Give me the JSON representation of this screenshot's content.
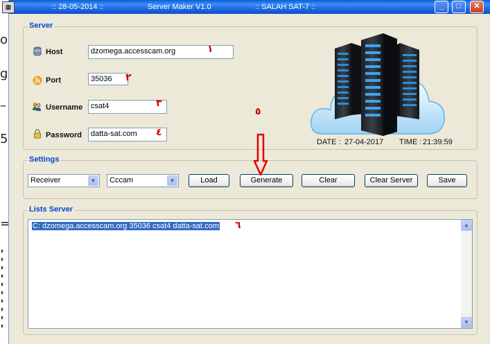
{
  "background": {
    "frag1": "o",
    "frag2": "g",
    "frag3": "–",
    "frag4": "5",
    "frag5": "="
  },
  "titlebar": {
    "date_text": ":: 28-05-2014 ::",
    "app_title": "Server Maker V1.0",
    "author": ":: SALAH SAT-7 ::"
  },
  "server": {
    "legend": "Server",
    "host_label": "Host",
    "host_value": "dzomega.accesscam.org",
    "port_label": "Port",
    "port_value": "35036",
    "username_label": "Username",
    "username_value": "csat4",
    "password_label": "Password",
    "password_value": "datta-sat.com",
    "date_label": "DATE :",
    "date_value": "27-04-2017",
    "time_label": "TIME :",
    "time_value": "21:39:59"
  },
  "annotations": {
    "n1": "١",
    "n2": "٢",
    "n3": "٣",
    "n4": "٤",
    "n5": "٥",
    "n6": "٦"
  },
  "settings": {
    "legend": "Settings",
    "receiver_selected": "Receiver",
    "protocol_selected": "Cccam",
    "load_label": "Load",
    "generate_label": "Generate",
    "clear_label": "Clear",
    "clear_server_label": "Clear Server",
    "save_label": "Save"
  },
  "lists": {
    "legend": "Lists Server",
    "items": [
      "C: dzomega.accesscam.org 35036 csat4 datta-sat.com"
    ]
  },
  "icons": {
    "app": "app-icon",
    "host": "database-icon",
    "port": "rss-icon",
    "username": "users-icon",
    "password": "lock-icon",
    "servers": "server-rack-cloud-icon"
  },
  "colors": {
    "title_gradient": "#0a5fd7",
    "legend": "#0046d5",
    "annotation": "#cc0000",
    "selection": "#316ac5"
  }
}
